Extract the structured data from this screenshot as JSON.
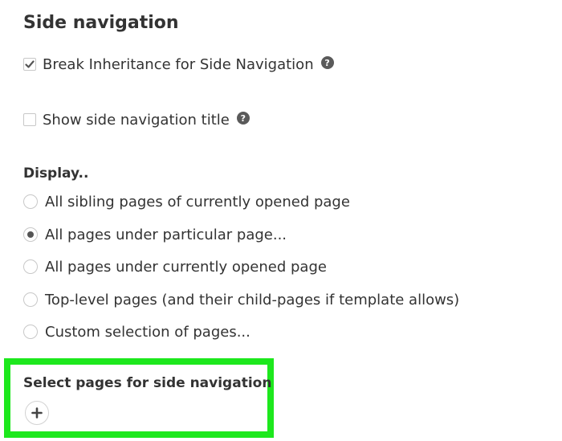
{
  "section": {
    "title": "Side navigation"
  },
  "options": {
    "break_inheritance": {
      "label": "Break Inheritance for Side Navigation",
      "checked": true,
      "help_icon": "question-circle-icon"
    },
    "show_title": {
      "label": "Show side navigation title",
      "checked": false,
      "help_icon": "question-circle-icon"
    }
  },
  "display": {
    "label": "Display..",
    "selected_index": 1,
    "choices": [
      "All sibling pages of currently opened page",
      "All pages under particular page...",
      "All pages under currently opened page",
      "Top-level pages (and their child-pages if template allows)",
      "Custom selection of pages..."
    ]
  },
  "select_pages": {
    "label": "Select pages for side navigation",
    "add_icon": "plus-icon",
    "highlight_color": "#1de81d"
  },
  "colors": {
    "text": "#333333",
    "border": "#c8c8c8",
    "radio_dot": "#555555",
    "help_icon_bg": "#5a5a5a"
  }
}
